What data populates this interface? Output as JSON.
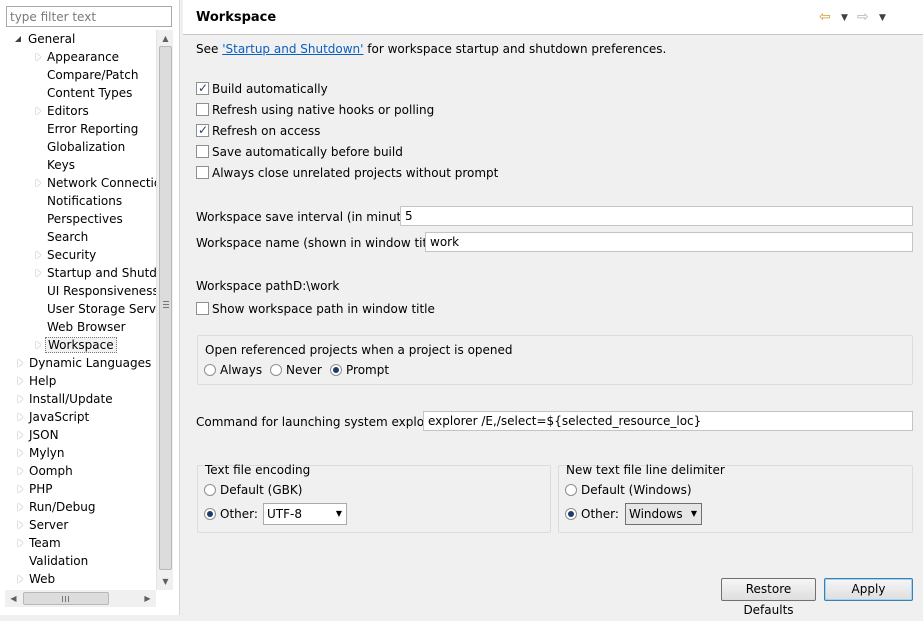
{
  "filter": {
    "placeholder": "type filter text"
  },
  "tree": {
    "general": "General",
    "general_children": [
      "Appearance",
      "Compare/Patch",
      "Content Types",
      "Editors",
      "Error Reporting",
      "Globalization",
      "Keys",
      "Network Connection",
      "Notifications",
      "Perspectives",
      "Search",
      "Security",
      "Startup and Shutdown",
      "UI Responsiveness M",
      "User Storage Service",
      "Web Browser",
      "Workspace"
    ],
    "roots": [
      "Dynamic Languages",
      "Help",
      "Install/Update",
      "JavaScript",
      "JSON",
      "Mylyn",
      "Oomph",
      "PHP",
      "Run/Debug",
      "Server",
      "Team",
      "Validation",
      "Web"
    ],
    "selected": "Workspace"
  },
  "scrollbars": {
    "h_grip": "III",
    "v_grip": "≡"
  },
  "header": {
    "title": "Workspace",
    "back_icon": "arrow-left-icon",
    "forward_icon": "arrow-right-icon"
  },
  "intro": {
    "prefix": "See ",
    "link": "'Startup and Shutdown'",
    "suffix": " for workspace startup and shutdown preferences."
  },
  "checkboxes": [
    {
      "label": "Build automatically",
      "checked": true
    },
    {
      "label": "Refresh using native hooks or polling",
      "checked": false
    },
    {
      "label": "Refresh on access",
      "checked": true
    },
    {
      "label": "Save automatically before build",
      "checked": false
    },
    {
      "label": "Always close unrelated projects without prompt",
      "checked": false
    }
  ],
  "save_interval": {
    "label": "Workspace save interval (in minutes):",
    "value": "5"
  },
  "workspace_name": {
    "label": "Workspace name (shown in window title):",
    "value": "work"
  },
  "workspace_path": {
    "label": "Workspace path:",
    "value": "D:\\work"
  },
  "show_path": {
    "label": "Show workspace path in window title",
    "checked": false
  },
  "open_projects": {
    "title": "Open referenced projects when a project is opened",
    "options": [
      "Always",
      "Never",
      "Prompt"
    ],
    "selected": "Prompt"
  },
  "explorer": {
    "label": "Command for launching system explorer:",
    "value": "explorer /E,/select=${selected_resource_loc}"
  },
  "encoding": {
    "title": "Text file encoding",
    "default_label": "Default (GBK)",
    "other_label": "Other:",
    "selected": "Other",
    "value": "UTF-8"
  },
  "line_delimiter": {
    "title": "New text file line delimiter",
    "default_label": "Default (Windows)",
    "other_label": "Other:",
    "selected": "Other",
    "value": "Windows"
  },
  "buttons": {
    "restore": "Restore Defaults",
    "apply": "Apply"
  },
  "colors": {
    "link": "#0b5fbf",
    "accent": "#3c7fb1"
  }
}
